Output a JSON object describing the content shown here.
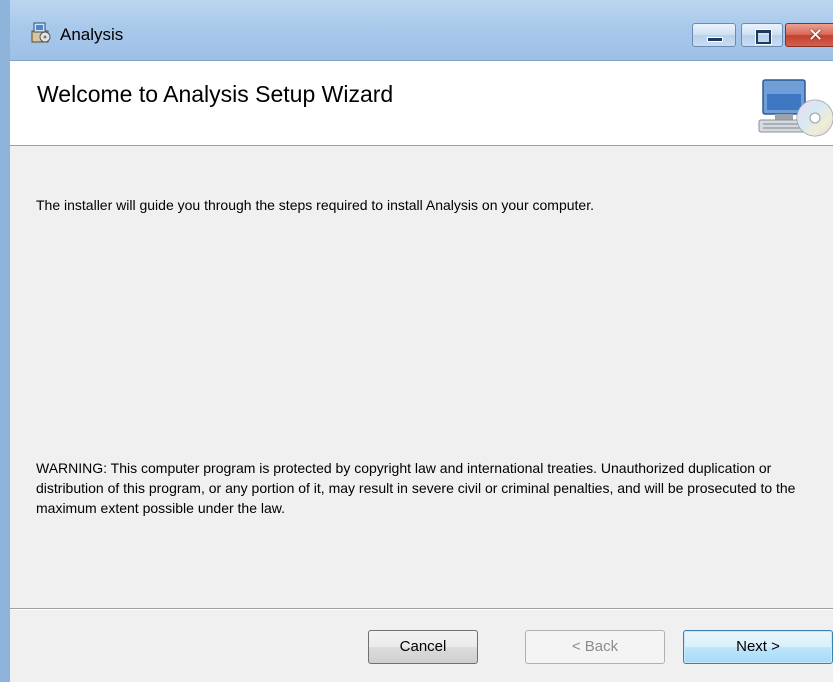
{
  "window": {
    "title": "Analysis",
    "controls": {
      "minimize_icon": "minimize-icon",
      "maximize_icon": "maximize-icon",
      "close_icon": "close-icon"
    }
  },
  "header": {
    "title": "Welcome to Analysis Setup Wizard",
    "art_icon": "computer-cd-icon"
  },
  "body": {
    "intro": "The installer will guide you through the steps required to install Analysis on your computer.",
    "warning": "WARNING: This computer program is protected by copyright law and international treaties. Unauthorized duplication or distribution of this program, or any portion of it, may result in severe civil or criminal penalties, and will be prosecuted to the maximum extent possible under the law."
  },
  "buttons": {
    "cancel": "Cancel",
    "back": "< Back",
    "next": "Next >"
  },
  "colors": {
    "titlebar": "#a9c9eb",
    "dialog_background": "#f0f0f0",
    "header_background": "#ffffff",
    "close_button": "#c6402e",
    "default_button_border": "#3c7fb1"
  }
}
